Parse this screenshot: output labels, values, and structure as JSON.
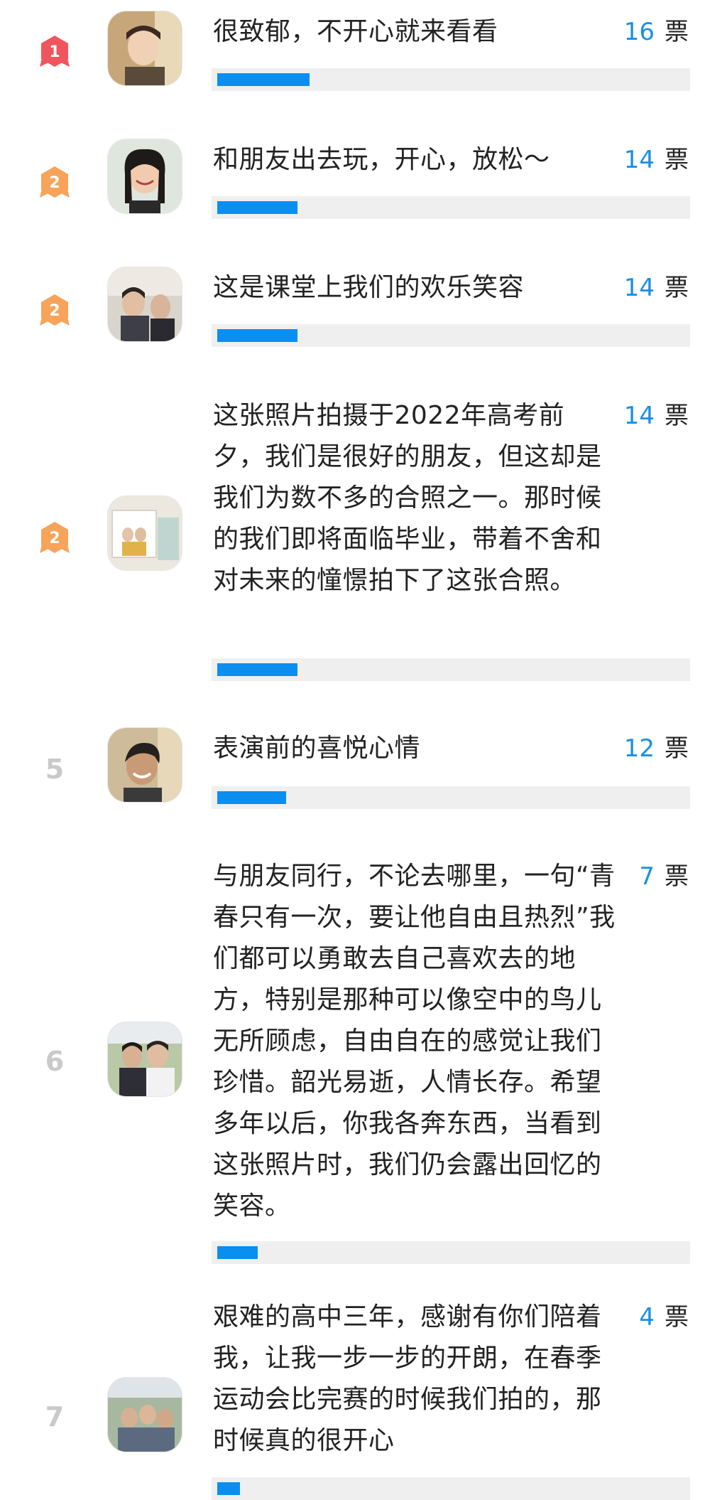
{
  "unit": "票",
  "max_votes": 16,
  "colors": {
    "accent_blue": "#0a8ff0",
    "vote_number_blue": "#1a8fe6",
    "medal_red": "#f0545c",
    "medal_orange": "#f7a35a",
    "rank_gray": "#c9c9c9",
    "bar_track": "#efefef"
  },
  "entries": [
    {
      "rank": "1",
      "medal": "medal-1-icon",
      "text": "很致郁，不开心就来看看",
      "votes": "16"
    },
    {
      "rank": "2",
      "medal": "medal-2-icon",
      "text": "和朋友出去玩，开心，放松～",
      "votes": "14"
    },
    {
      "rank": "2",
      "medal": "medal-2-icon",
      "text": "这是课堂上我们的欢乐笑容",
      "votes": "14"
    },
    {
      "rank": "2",
      "medal": "medal-2-icon",
      "text": "这张照片拍摄于2022年高考前夕，我们是很好的朋友，但这却是我们为数不多的合照之一。那时候的我们即将面临毕业，带着不舍和对未来的憧憬拍下了这张合照。",
      "votes": "14"
    },
    {
      "rank": "5",
      "medal": null,
      "text": "表演前的喜悦心情",
      "votes": "12"
    },
    {
      "rank": "6",
      "medal": null,
      "text": "与朋友同行，不论去哪里，一句“青春只有一次，要让他自由且热烈”我们都可以勇敢去自己喜欢去的地方，特别是那种可以像空中的鸟儿无所顾虑，自由自在的感觉让我们珍惜。韶光易逝，人情长存。希望多年以后，你我各奔东西，当看到这张照片时，我们仍会露出回忆的笑容。",
      "votes": "7"
    },
    {
      "rank": "7",
      "medal": null,
      "text": "艰难的高中三年，感谢有你们陪着我，让我一步一步的开朗，在春季运动会比完赛的时候我们拍的，那时候真的很开心",
      "votes": "4"
    }
  ]
}
